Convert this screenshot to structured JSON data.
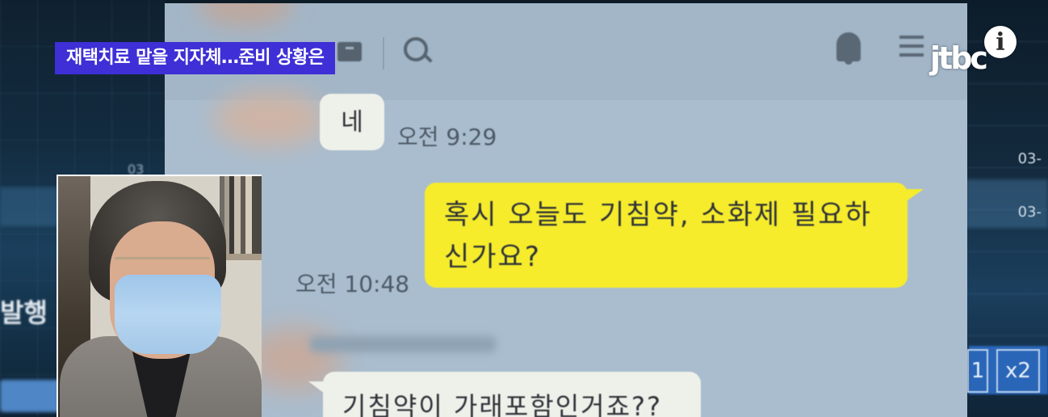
{
  "caption": {
    "text": "재택치료 맡을 지자체…준비 상황은",
    "background": "#3e2fd6"
  },
  "broadcaster": {
    "logo_text": "jtbc",
    "info_label": "i"
  },
  "background_monitor": {
    "left_label": "발행",
    "left_number": "03",
    "right_numbers": [
      "03-",
      "03-"
    ],
    "right_buttons": [
      "1",
      "x2"
    ]
  },
  "chat": {
    "messages": [
      {
        "text": "네",
        "time": "오전 9:29",
        "sender": "other"
      },
      {
        "text_line1": "혹시 오늘도 기침약, 소화제 필요하",
        "text_line2": "신가요?",
        "time": "오전 10:48",
        "sender": "me",
        "color": "#f6ec2c"
      },
      {
        "text": "기침약이 가래포함인거죠??",
        "sender": "other"
      }
    ],
    "header_icons": [
      "drawer-icon",
      "search-icon",
      "bell-icon",
      "menu-icon"
    ]
  },
  "colors": {
    "chat_background": "#a9bdcf",
    "my_bubble": "#f6ec2c",
    "other_bubble": "#eef0ea"
  }
}
